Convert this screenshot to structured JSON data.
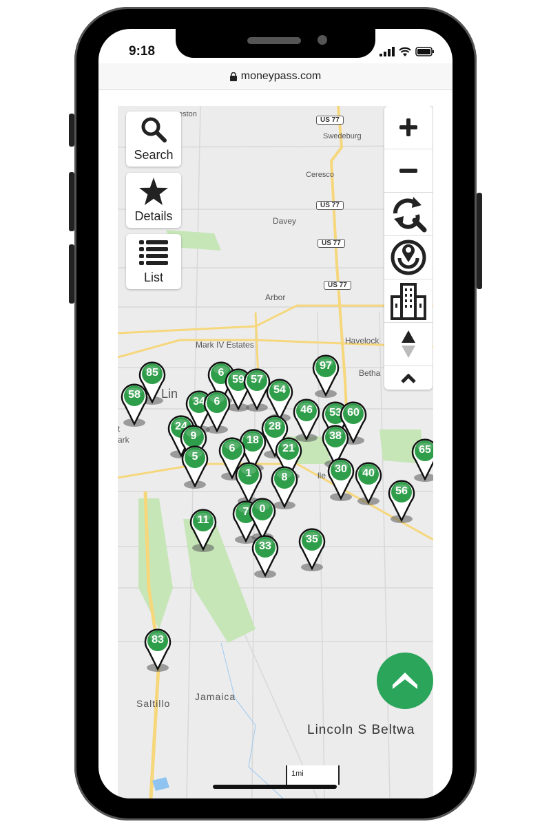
{
  "status_bar": {
    "time": "9:18",
    "icons": [
      "signal-icon",
      "wifi-icon",
      "battery-icon"
    ]
  },
  "browser": {
    "url": "moneypass.com",
    "lock_icon": "lock-icon"
  },
  "left_controls": [
    {
      "label": "Search",
      "icon": "search-icon"
    },
    {
      "label": "Details",
      "icon": "star-icon"
    },
    {
      "label": "List",
      "icon": "list-icon"
    }
  ],
  "right_toolbar": [
    {
      "name": "zoom-in",
      "icon": "plus-icon"
    },
    {
      "name": "zoom-out",
      "icon": "minus-icon"
    },
    {
      "name": "search-area",
      "icon": "refresh-search-icon"
    },
    {
      "name": "my-location",
      "icon": "location-target-icon"
    },
    {
      "name": "buildings",
      "icon": "building-icon"
    },
    {
      "name": "sort",
      "icon": "sort-arrows-icon"
    },
    {
      "name": "collapse",
      "icon": "chevron-up-icon"
    }
  ],
  "map": {
    "place_labels": [
      "eston",
      "Swedeburg",
      "Ceresco",
      "Davey",
      "Arbor",
      "Mark IV Estates",
      "Havelock",
      "Betha",
      "Lin",
      "t",
      "ark",
      "lle",
      "Saltillo",
      "Jamaica",
      "Lincoln S Beltwa"
    ],
    "road_shields": [
      "US 77",
      "US 77",
      "US 77",
      "US 77"
    ],
    "pins": [
      "85",
      "58",
      "6",
      "59",
      "57",
      "54",
      "34",
      "6",
      "24",
      "9",
      "5",
      "28",
      "18",
      "6",
      "21",
      "97",
      "46",
      "53",
      "60",
      "38",
      "65",
      "1",
      "8",
      "30",
      "40",
      "56",
      "11",
      "7",
      "0",
      "33",
      "35",
      "83"
    ],
    "scale_label": "1mi"
  },
  "fab": {
    "icon": "chevron-up-icon"
  },
  "colors": {
    "pin_green": "#2f9e4a",
    "fab_green": "#2aa55a",
    "road_yellow": "#f6d77c",
    "park_green": "#b5e0a6"
  }
}
